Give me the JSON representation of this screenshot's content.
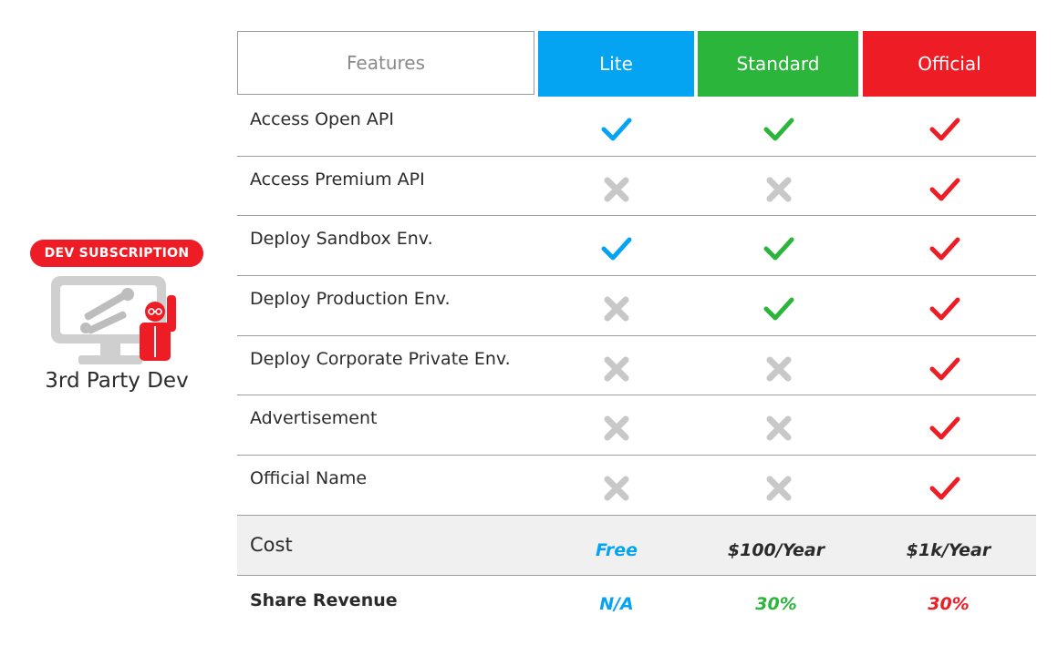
{
  "persona": {
    "badge": "DEV SUBSCRIPTION",
    "label": "3rd Party Dev",
    "illustration_icon": "developer-at-monitor-with-tools-icon"
  },
  "table": {
    "columns": {
      "features": "Features",
      "lite": "Lite",
      "standard": "Standard",
      "official": "Official"
    },
    "colors": {
      "lite": "#04a4f3",
      "standard": "#2bb53a",
      "official": "#ee1c25",
      "no": "#c8c8c8"
    },
    "rows": [
      {
        "label": "Access Open API",
        "lite": true,
        "standard": true,
        "official": true
      },
      {
        "label": "Access Premium API",
        "lite": false,
        "standard": false,
        "official": true
      },
      {
        "label": "Deploy Sandbox Env.",
        "lite": true,
        "standard": true,
        "official": true
      },
      {
        "label": "Deploy Production Env.",
        "lite": false,
        "standard": true,
        "official": true
      },
      {
        "label": "Deploy Corporate Private Env.",
        "lite": false,
        "standard": false,
        "official": true
      },
      {
        "label": "Advertisement",
        "lite": false,
        "standard": false,
        "official": true
      },
      {
        "label": "Official Name",
        "lite": false,
        "standard": false,
        "official": true
      }
    ],
    "cost": {
      "label": "Cost",
      "lite": "Free",
      "standard": "$100/Year",
      "official": "$1k/Year"
    },
    "share_revenue": {
      "label": "Share Revenue",
      "lite": "N/A",
      "standard": "30%",
      "official": "30%"
    }
  }
}
